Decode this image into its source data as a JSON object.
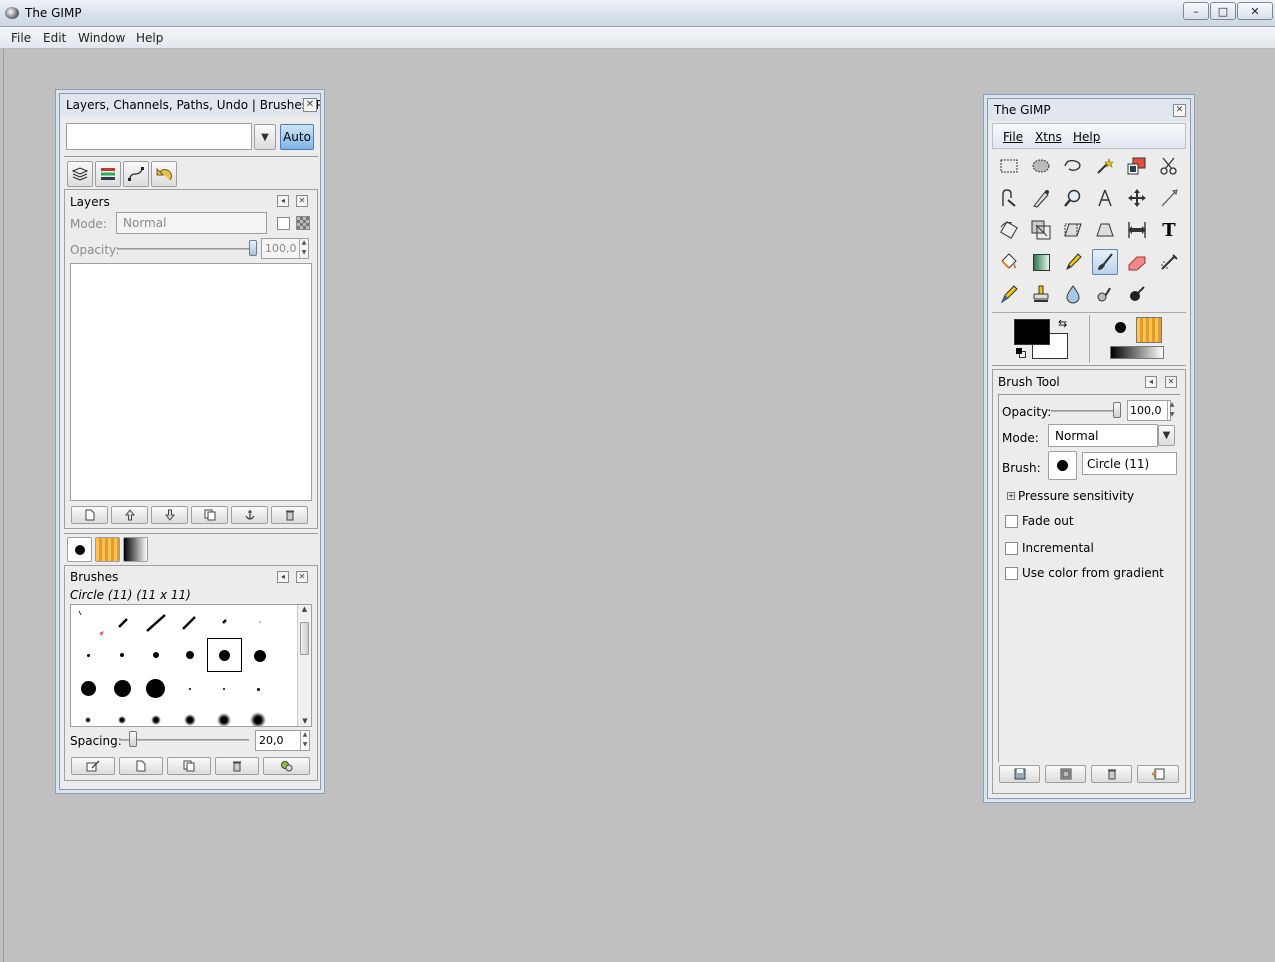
{
  "window": {
    "title": "The GIMP",
    "min_glyph": "–",
    "max_glyph": "□",
    "close_glyph": "✕"
  },
  "menubar": {
    "items": [
      "File",
      "Edit",
      "Window",
      "Help"
    ]
  },
  "left_dock": {
    "title": "Layers, Channels, Paths, Undo | Brushes, P...",
    "image_select_value": "",
    "auto_label": "Auto",
    "tabs": [
      "layers-tab",
      "channels-tab",
      "paths-tab",
      "undo-tab"
    ],
    "layers": {
      "title": "Layers",
      "mode_label": "Mode:",
      "mode_value": "Normal",
      "opacity_label": "Opacity:",
      "opacity_value": "100,0",
      "opacity_level": 1.0,
      "buttons": [
        "new-layer",
        "raise-layer",
        "lower-layer",
        "duplicate-layer",
        "anchor-layer",
        "delete-layer"
      ]
    },
    "resource_tabs": [
      "brushes-tab",
      "patterns-tab",
      "gradients-tab"
    ],
    "brushes": {
      "title": "Brushes",
      "current": "Circle (11) (11 x 11)",
      "spacing_label": "Spacing:",
      "spacing_value": "20,0",
      "spacing_level": 0.2,
      "buttons": [
        "edit-brush",
        "new-brush",
        "duplicate-brush",
        "delete-brush",
        "refresh-brushes"
      ]
    }
  },
  "toolbox": {
    "title": "The GIMP",
    "menu": [
      "File",
      "Xtns",
      "Help"
    ],
    "colors": {
      "foreground": "#000000",
      "background": "#ffffff",
      "pattern_color": "#f2b24a"
    },
    "tool_options": {
      "title": "Brush Tool",
      "opacity_label": "Opacity:",
      "opacity_value": "100,0",
      "opacity_level": 1.0,
      "mode_label": "Mode:",
      "mode_value": "Normal",
      "brush_label": "Brush:",
      "brush_value": "Circle (11)",
      "pressure_label": "Pressure sensitivity",
      "fade_label": "Fade out",
      "incremental_label": "Incremental",
      "gradient_label": "Use color from gradient",
      "buttons": [
        "save-options",
        "restore-options",
        "delete-options",
        "reset-options"
      ]
    }
  }
}
